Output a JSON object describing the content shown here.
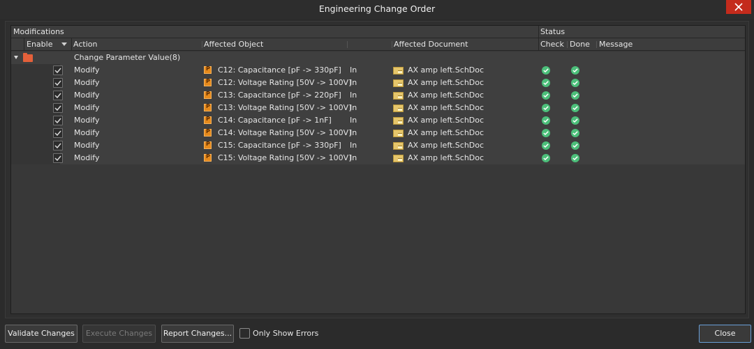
{
  "window": {
    "title": "Engineering Change Order"
  },
  "groups": {
    "modifications": "Modifications",
    "status": "Status"
  },
  "columns": {
    "enable": "Enable",
    "action": "Action",
    "affected_object": "Affected Object",
    "affected_document": "Affected Document",
    "check": "Check",
    "done": "Done",
    "message": "Message"
  },
  "group_row": {
    "label": "Change Parameter Value(8)"
  },
  "rows": [
    {
      "enabled": true,
      "action": "Modify",
      "object": "C12: Capacitance [pF -> 330pF]",
      "dir": "In",
      "document": "AX amp left.SchDoc",
      "check": "ok",
      "done": "ok",
      "message": ""
    },
    {
      "enabled": true,
      "action": "Modify",
      "object": "C12: Voltage Rating [50V -> 100V]",
      "dir": "In",
      "document": "AX amp left.SchDoc",
      "check": "ok",
      "done": "ok",
      "message": ""
    },
    {
      "enabled": true,
      "action": "Modify",
      "object": "C13: Capacitance [pF -> 220pF]",
      "dir": "In",
      "document": "AX amp left.SchDoc",
      "check": "ok",
      "done": "ok",
      "message": ""
    },
    {
      "enabled": true,
      "action": "Modify",
      "object": "C13: Voltage Rating [50V -> 100V]",
      "dir": "In",
      "document": "AX amp left.SchDoc",
      "check": "ok",
      "done": "ok",
      "message": ""
    },
    {
      "enabled": true,
      "action": "Modify",
      "object": "C14: Capacitance [pF -> 1nF]",
      "dir": "In",
      "document": "AX amp left.SchDoc",
      "check": "ok",
      "done": "ok",
      "message": ""
    },
    {
      "enabled": true,
      "action": "Modify",
      "object": "C14: Voltage Rating [50V -> 100V]",
      "dir": "In",
      "document": "AX amp left.SchDoc",
      "check": "ok",
      "done": "ok",
      "message": ""
    },
    {
      "enabled": true,
      "action": "Modify",
      "object": "C15: Capacitance [pF -> 330pF]",
      "dir": "In",
      "document": "AX amp left.SchDoc",
      "check": "ok",
      "done": "ok",
      "message": ""
    },
    {
      "enabled": true,
      "action": "Modify",
      "object": "C15: Voltage Rating [50V -> 100V]",
      "dir": "In",
      "document": "AX amp left.SchDoc",
      "check": "ok",
      "done": "ok",
      "message": ""
    }
  ],
  "parameter_icon_letter": "P",
  "footer": {
    "validate": "Validate Changes",
    "execute": "Execute Changes",
    "report": "Report Changes...",
    "only_errors": "Only Show Errors",
    "close": "Close"
  },
  "colors": {
    "accent_close": "#c42b1c",
    "status_ok": "#4cbf7a",
    "param_icon": "#e68a1c"
  },
  "icons": {
    "close_window": "close-icon",
    "expand": "collapse-arrow-icon",
    "folder": "folder-icon",
    "parameter": "parameter-icon",
    "document": "schematic-document-icon",
    "status_ok": "check-circle-icon"
  }
}
